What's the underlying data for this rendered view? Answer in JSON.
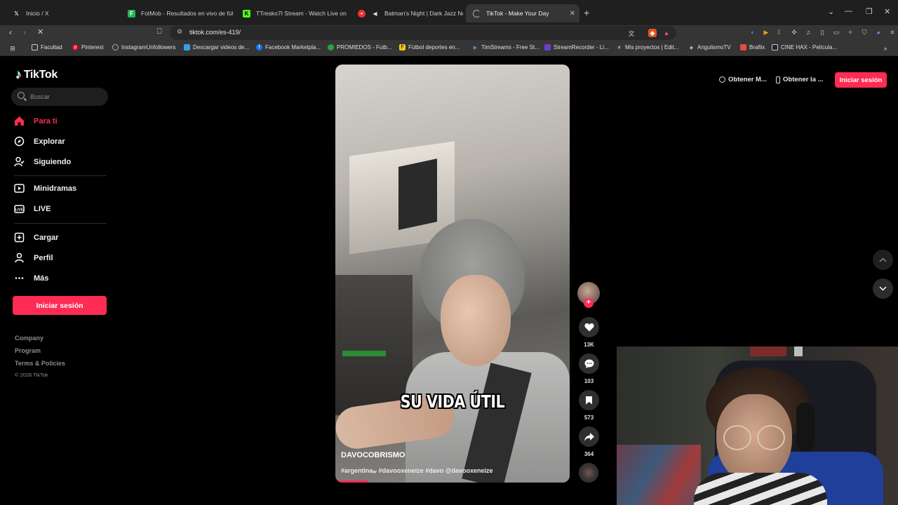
{
  "browser": {
    "tabs": [
      {
        "title": "Inicio / X",
        "icon": "x-logo-icon"
      },
      {
        "title": "FotMob - Resultados en vivo de fútb",
        "icon": "fotmob-icon"
      },
      {
        "title": "TTresko7I Stream - Watch Live on Kic",
        "icon": "kick-icon"
      },
      {
        "title": "Batman's Night | Dark Jazz Noir f",
        "icon": "youtube-icon"
      },
      {
        "title": "TikTok - Make Your Day",
        "icon": "loading-spinner-icon"
      }
    ],
    "url": "tiktok.com/es-419/",
    "bookmarks": [
      "Facultad",
      "Pinterest",
      "InstagramUnfollowers",
      "Descargar videos de...",
      "Facebook Marketpla...",
      "PROMIEDOS - Futb...",
      "Fútbol deportes en...",
      "TimStreams - Free St...",
      "StreamRecorder - Li...",
      "Mis proyectos | Edit...",
      "AngulismoTV",
      "Braflix",
      "CINE HAX - Película..."
    ]
  },
  "tiktok": {
    "logo": "TikTok",
    "search_placeholder": "Buscar",
    "nav": [
      {
        "label": "Para ti"
      },
      {
        "label": "Explorar"
      },
      {
        "label": "Siguiendo"
      },
      {
        "label": "Minidramas"
      },
      {
        "label": "LIVE"
      },
      {
        "label": "Cargar"
      },
      {
        "label": "Perfil"
      },
      {
        "label": "Más"
      }
    ],
    "login_sidebar": "Iniciar sesión",
    "footer": [
      "Company",
      "Program",
      "Terms & Policies"
    ],
    "copyright": "© 2026 TikTok",
    "top": {
      "get_app_1": "Obtener M...",
      "get_app_2": "Obtener la ...",
      "login": "Iniciar sesión"
    },
    "video": {
      "caption": "SU VIDA ÚTIL",
      "author": "DAVOCOBRISMO",
      "description": "#argentinaₐᵣ #davooxeneize #davo @davooxeneize",
      "progress": 0.14
    },
    "actions": {
      "likes": "13K",
      "comments": "103",
      "saves": "573",
      "shares": "364"
    }
  },
  "colors": {
    "accent": "#fe2c55",
    "background": "#000000"
  }
}
